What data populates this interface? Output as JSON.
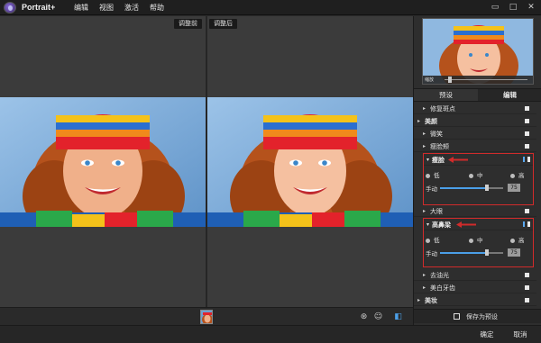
{
  "app": {
    "title": "Portrait+"
  },
  "menu": [
    "编辑",
    "视图",
    "激活",
    "帮助"
  ],
  "window_controls": [
    "□",
    "□",
    "✕"
  ],
  "viewer": {
    "before_label": "调整前",
    "after_label": "调整后"
  },
  "panel": {
    "preview": {
      "zoom_text": "缩放"
    },
    "tabs": [
      {
        "label": "预设",
        "active": false
      },
      {
        "label": "编辑",
        "active": true
      }
    ],
    "items": [
      {
        "label": "修复斑点",
        "bold": false,
        "top": false
      },
      {
        "label": "美颜",
        "bold": true,
        "top": false
      },
      {
        "label": "微笑",
        "bold": false,
        "top": false
      },
      {
        "label": "瘦脸颊",
        "bold": false,
        "top": false
      }
    ],
    "group1": {
      "title": "瘦脸",
      "options": [
        "低",
        "中",
        "高"
      ],
      "manual_label": "手动",
      "manual_value": "75",
      "level_fraction": 0.75
    },
    "mid_item": {
      "label": "大眼"
    },
    "group2": {
      "title": "高鼻梁",
      "options": [
        "低",
        "中",
        "高"
      ],
      "manual_label": "手动",
      "manual_value": "75",
      "level_fraction": 0.75
    },
    "bottom_items": [
      {
        "label": "去油光"
      },
      {
        "label": "美白牙齿"
      },
      {
        "label": "美妆"
      }
    ],
    "save_preset": "保存为预设"
  },
  "footer": {
    "ok": "确定",
    "cancel": "取消"
  },
  "colors": {
    "highlight": "#d12b2b",
    "accent": "#4b9fe8"
  }
}
